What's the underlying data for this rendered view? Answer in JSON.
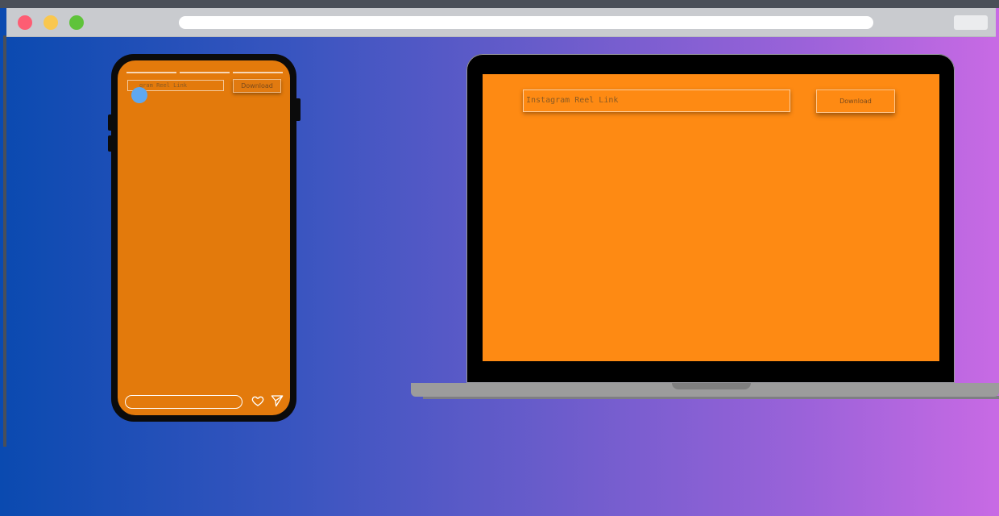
{
  "browser": {
    "window_controls": [
      "close",
      "minimize",
      "maximize"
    ],
    "address_bar": {
      "value": ""
    }
  },
  "phone": {
    "input": {
      "placeholder": "Instagram Reel Link",
      "visible_text": "gram Reel Link"
    },
    "download_label": "Download",
    "icons": [
      "heart-icon",
      "send-icon"
    ]
  },
  "laptop": {
    "input": {
      "placeholder": "Instagram Reel Link"
    },
    "download_label": "Download"
  },
  "colors": {
    "phone_screen": "#e37a0c",
    "laptop_screen": "#fe8a13",
    "cursor": "#5fa8f0",
    "background_start": "#0a4ab0",
    "background_end": "#c86ae4"
  }
}
